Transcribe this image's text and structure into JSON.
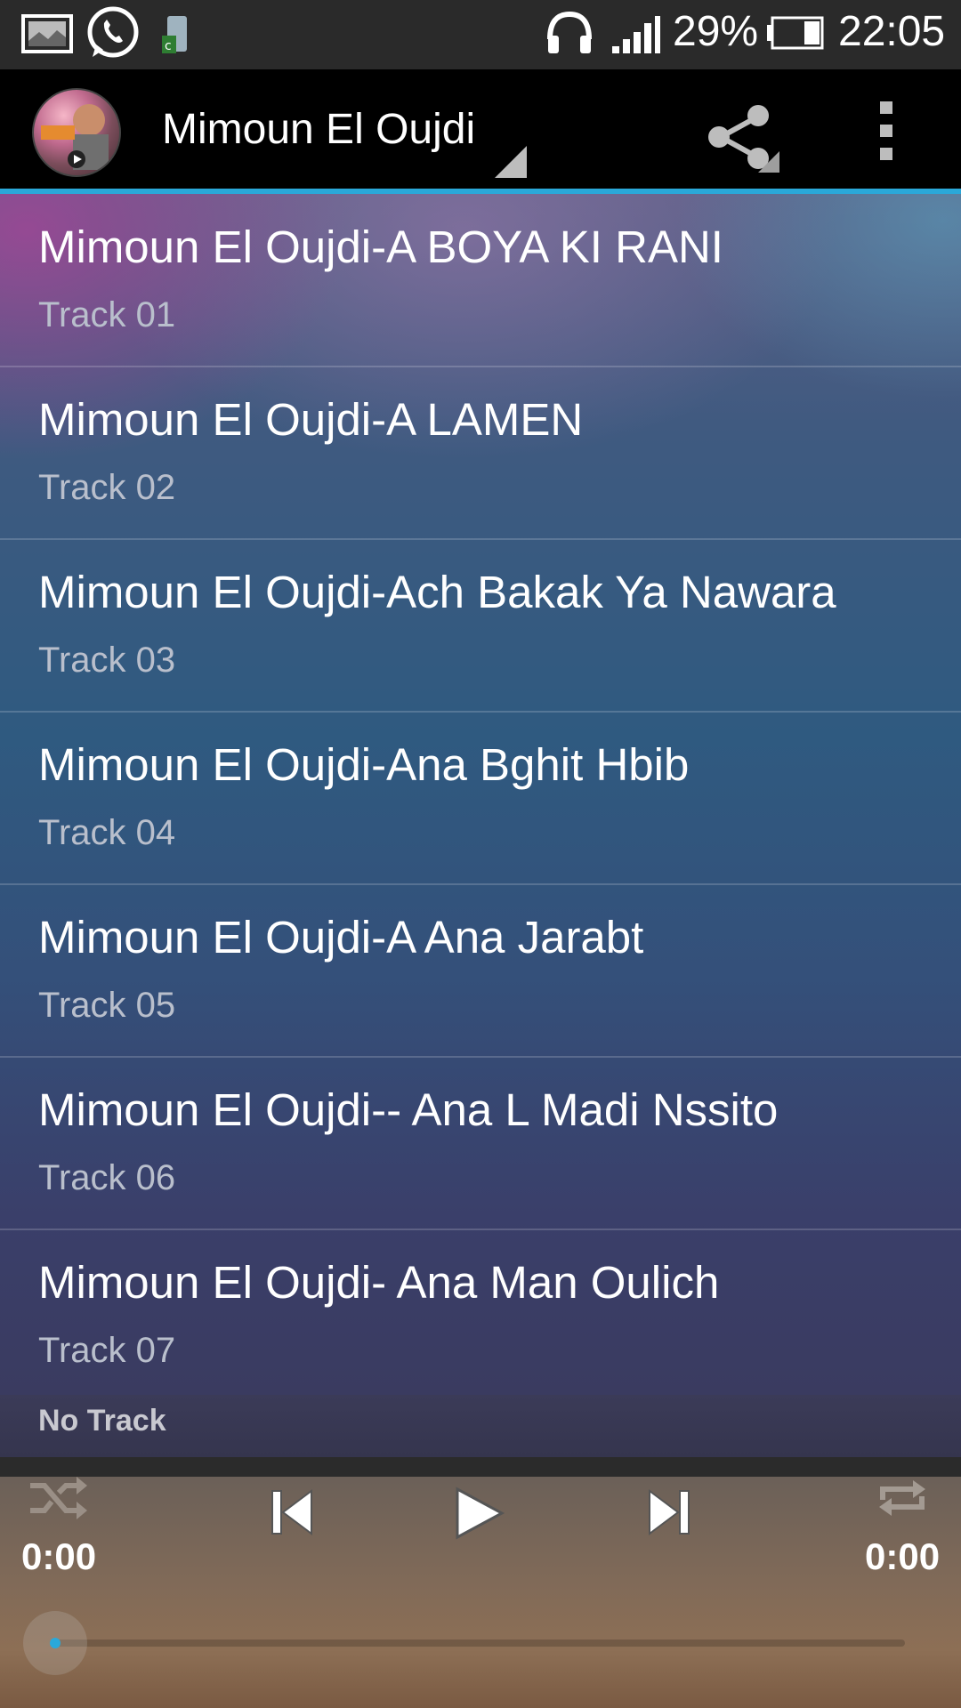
{
  "status_bar": {
    "battery_percent": "29%",
    "time": "22:05",
    "icons": [
      "gallery-icon",
      "whatsapp-icon",
      "clean-master-icon",
      "headphones-icon",
      "signal-icon",
      "battery-icon"
    ]
  },
  "action_bar": {
    "title": "Mimoun El Oujdi",
    "share_icon": "share-icon",
    "overflow_icon": "overflow-menu-icon"
  },
  "tracks": [
    {
      "title": "Mimoun El Oujdi-A BOYA KI RANI",
      "subtitle": "Track 01"
    },
    {
      "title": "Mimoun El Oujdi-A LAMEN",
      "subtitle": "Track 02"
    },
    {
      "title": "Mimoun El Oujdi-Ach Bakak Ya Nawara",
      "subtitle": "Track 03"
    },
    {
      "title": "Mimoun El Oujdi-Ana Bghit Hbib",
      "subtitle": "Track 04"
    },
    {
      "title": "Mimoun El Oujdi-A Ana Jarabt",
      "subtitle": "Track 05"
    },
    {
      "title": "Mimoun El Oujdi-- Ana L Madi Nssito",
      "subtitle": "Track 06"
    },
    {
      "title": "Mimoun El Oujdi- Ana Man Oulich",
      "subtitle": "Track 07"
    }
  ],
  "now_playing": {
    "label": "No Track"
  },
  "player": {
    "elapsed": "0:00",
    "duration": "0:00",
    "progress": 0,
    "accent_color": "#2aa8d9",
    "icons": [
      "shuffle-icon",
      "previous-icon",
      "play-icon",
      "next-icon",
      "repeat-icon"
    ]
  }
}
